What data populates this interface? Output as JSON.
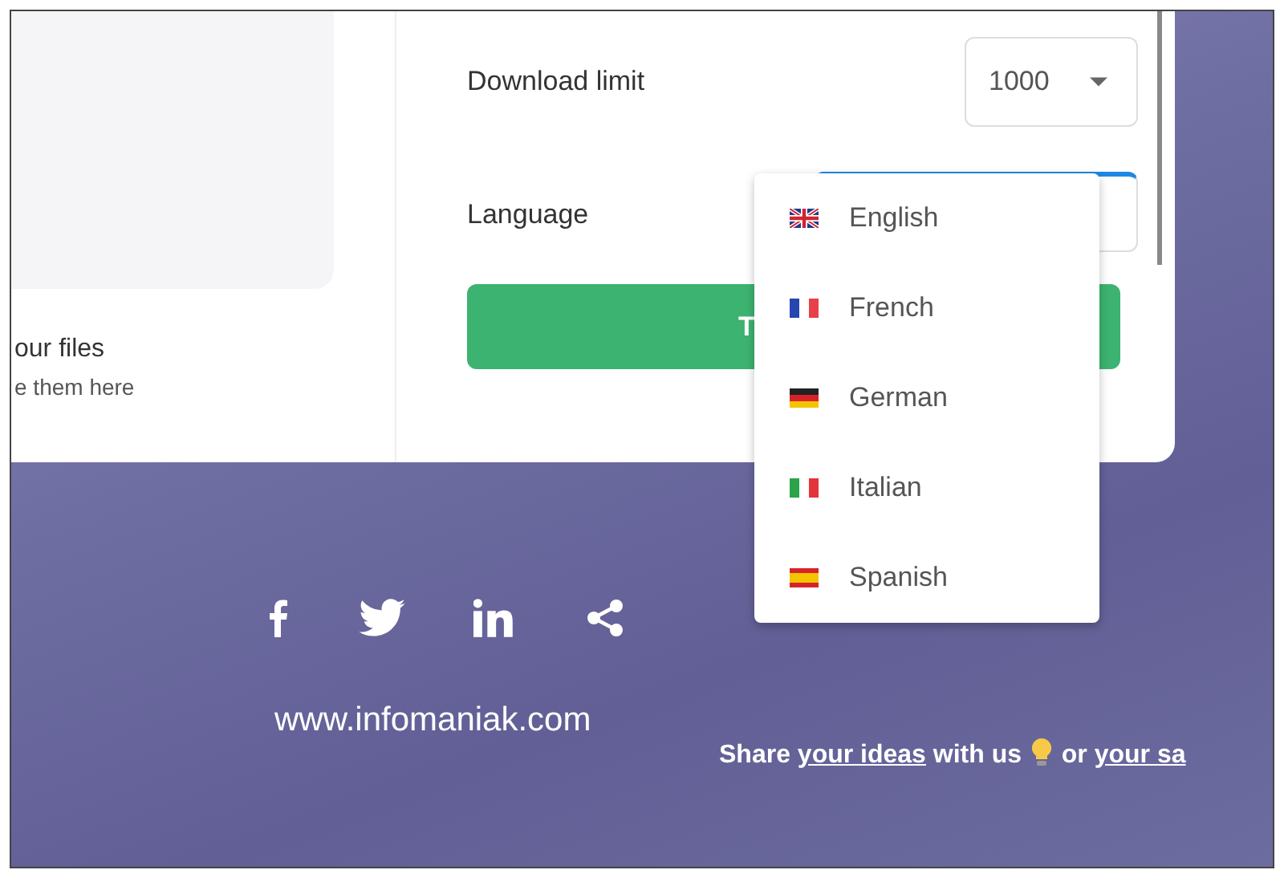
{
  "upload_panel": {
    "title": "our files",
    "subtitle": "e them here"
  },
  "settings": [
    {
      "label": "Download limit",
      "value": "1000"
    },
    {
      "label": "Language"
    }
  ],
  "transfer_button": {
    "label": "T"
  },
  "language_menu": {
    "open": true,
    "items": [
      {
        "label": "English",
        "kind": "uk"
      },
      {
        "label": "French",
        "kind": "fr"
      },
      {
        "label": "German",
        "kind": "de"
      },
      {
        "label": "Italian",
        "kind": "it"
      },
      {
        "label": "Spanish",
        "kind": "es"
      }
    ]
  },
  "footer": {
    "social": [
      {
        "kind": "facebook"
      },
      {
        "kind": "twitter"
      },
      {
        "kind": "linkedin"
      },
      {
        "kind": "share"
      }
    ],
    "website": "www.infomaniak.com",
    "message": [
      {
        "kind": "text",
        "text": "Share "
      },
      {
        "kind": "link",
        "text": "your ideas"
      },
      {
        "kind": "text",
        "text": " with us "
      },
      {
        "kind": "bulb"
      },
      {
        "kind": "text",
        "text": " or "
      },
      {
        "kind": "link",
        "text": "your sa"
      }
    ]
  }
}
